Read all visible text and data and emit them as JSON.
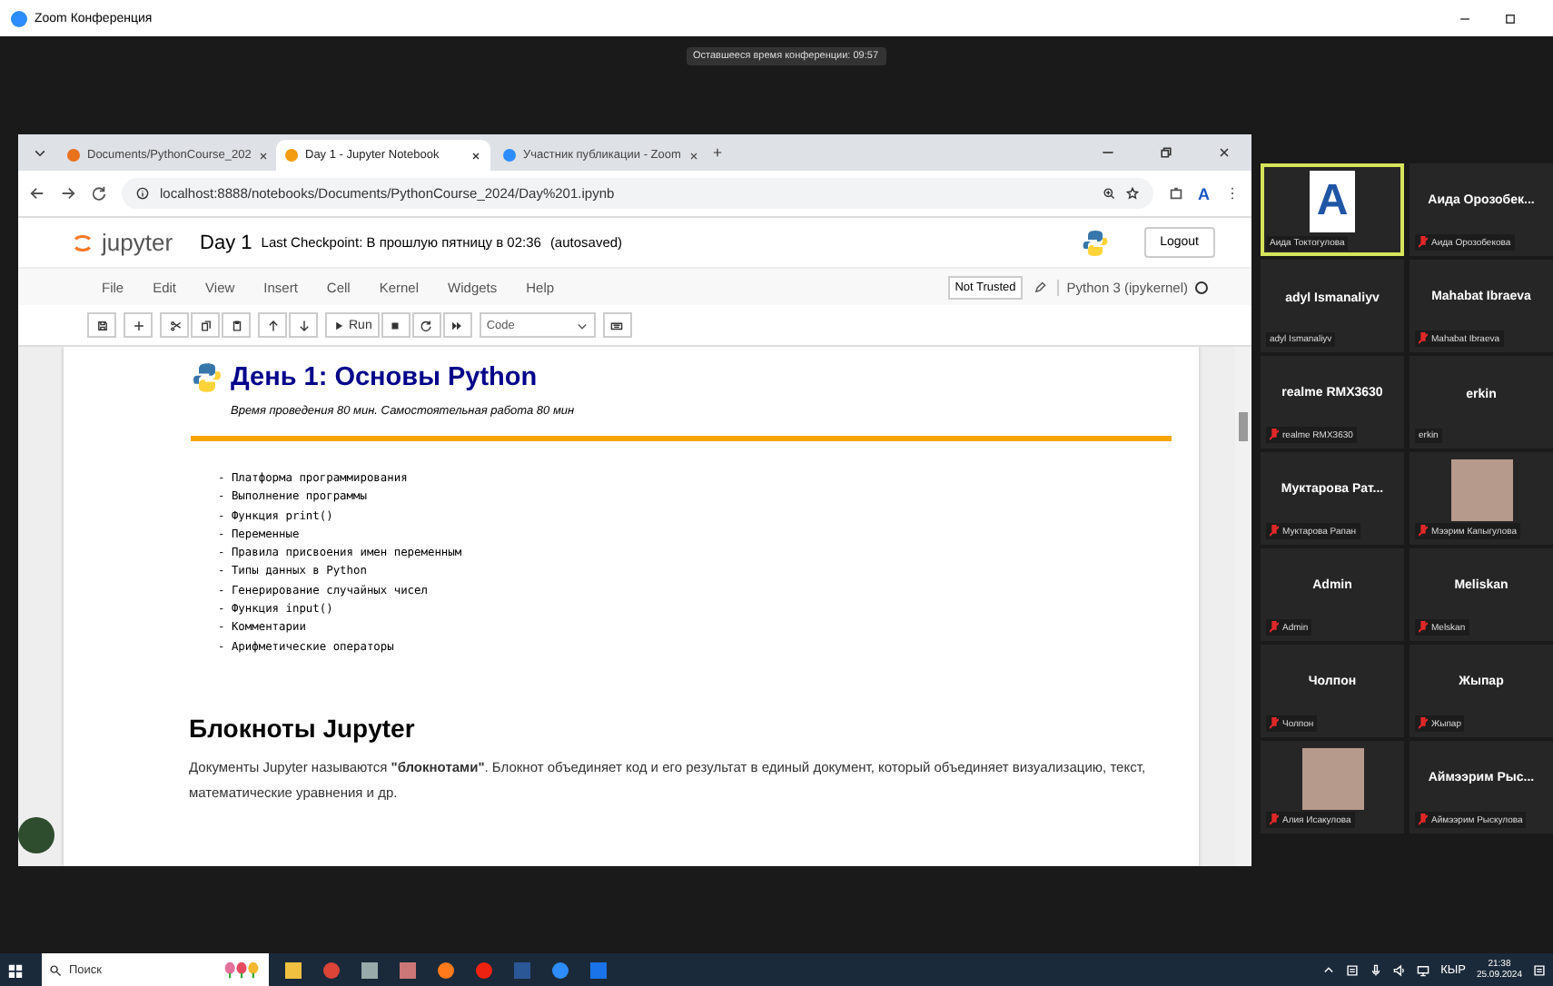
{
  "window": {
    "title": "Zoom Конференция"
  },
  "meeting_timer": "Оставшееся время конференции: 09:57",
  "browser": {
    "tabs": [
      {
        "label": "Documents/PythonCourse_202",
        "selected": false
      },
      {
        "label": "Day 1 - Jupyter Notebook",
        "selected": true
      },
      {
        "label": "Участник публикации - Zoom",
        "selected": false
      }
    ],
    "address": "localhost:8888/notebooks/Documents/PythonCourse_2024/Day%201.ipynb",
    "profile_letter": "A"
  },
  "jupyter": {
    "logo_text": "jupyter",
    "notebook_name": "Day 1",
    "checkpoint": "Last Checkpoint: В прошлую пятницу в 02:36",
    "autosave": "(autosaved)",
    "logout": "Logout",
    "menu": [
      "File",
      "Edit",
      "View",
      "Insert",
      "Cell",
      "Kernel",
      "Widgets",
      "Help"
    ],
    "trust": "Not Trusted",
    "kernel": "Python 3 (ipykernel)",
    "run_label": "Run",
    "cell_type": "Code"
  },
  "notebook": {
    "title": "День 1: Основы Python",
    "subtitle": "Время проведения 80 мин. Самостоятельная работа 80 мин",
    "topics": [
      "- Платформа программирования",
      "- Выполнение программы",
      "- Функция print()",
      "- Переменные",
      "- Правила присвоения имен переменным",
      "- Типы данных в Python",
      "- Генерирование случайных чисел",
      "- Функция input()",
      "- Комментарии",
      "- Арифметические операторы"
    ],
    "section_title": "Блокноты Jupyter",
    "paragraph": "Документы Jupyter называются **\"блокнотами\"**. Блокнот объединяет код и его результат в единый документ, который объединяет визуализацию, текст, математические уравнения и др."
  },
  "participants": [
    {
      "kind": "avatar",
      "letter": "A",
      "label": "Аида Токтогулова",
      "muted": false,
      "active": true
    },
    {
      "kind": "name",
      "name": "Аида Орозобек...",
      "label": "Аида Орозобекова",
      "muted": true,
      "active": false
    },
    {
      "kind": "name",
      "name": "adyl Ismanaliyv",
      "label": "adyl Ismanaliyv",
      "muted": false,
      "active": false
    },
    {
      "kind": "name",
      "name": "Mahabat Ibraeva",
      "label": "Mahabat Ibraeva",
      "muted": true,
      "active": false
    },
    {
      "kind": "name",
      "name": "realme RMX3630",
      "label": "realme RMX3630",
      "muted": true,
      "active": false
    },
    {
      "kind": "name",
      "name": "erkin",
      "label": "erkin",
      "muted": false,
      "active": false
    },
    {
      "kind": "name",
      "name": "Муктарова Рат...",
      "label": "Муктарова Рапан",
      "muted": true,
      "active": false
    },
    {
      "kind": "photo",
      "label": "Мээрим Капыгулова",
      "muted": true,
      "active": false
    },
    {
      "kind": "name",
      "name": "Admin",
      "label": "Admin",
      "muted": true,
      "active": false
    },
    {
      "kind": "name",
      "name": "Meliskan",
      "label": "Melskan",
      "muted": true,
      "active": false
    },
    {
      "kind": "name",
      "name": "Чолпон",
      "label": "Чолпон",
      "muted": true,
      "active": false
    },
    {
      "kind": "name",
      "name": "Жыпар",
      "label": "Жыпар",
      "muted": true,
      "active": false
    },
    {
      "kind": "photo",
      "label": "Алия Исакулова",
      "muted": true,
      "active": false
    },
    {
      "kind": "name",
      "name": "Аймээрим Рыс...",
      "label": "Аймээрим Рыскулова",
      "muted": true,
      "active": false
    }
  ],
  "taskbar": {
    "search_placeholder": "Поиск",
    "language": "КЫР",
    "time": "21:38",
    "date": "25.09.2024"
  }
}
